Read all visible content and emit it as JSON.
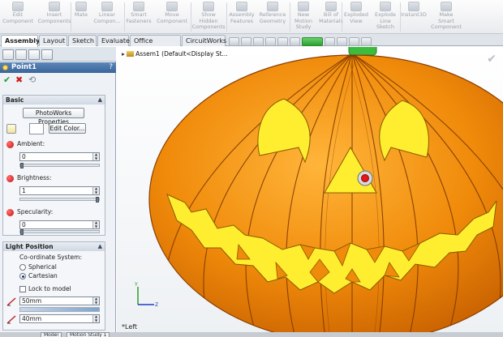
{
  "ribbon": {
    "items": [
      {
        "label": "Edit\nComponent",
        "icon": "edit-component-icon"
      },
      {
        "label": "Insert\nComponents",
        "icon": "insert-components-icon"
      },
      {
        "label": "Mate",
        "icon": "mate-icon"
      },
      {
        "label": "Linear\nCompon...",
        "icon": "linear-pattern-icon"
      },
      {
        "label": "Smart\nFasteners",
        "icon": "smart-fasteners-icon"
      },
      {
        "label": "Move\nComponent",
        "icon": "move-component-icon"
      },
      {
        "label": "Show\nHidden\nComponents",
        "icon": "show-hidden-icon"
      },
      {
        "label": "Assembly\nFeatures",
        "icon": "assembly-features-icon"
      },
      {
        "label": "Reference\nGeometry",
        "icon": "reference-geometry-icon"
      },
      {
        "label": "New\nMotion\nStudy",
        "icon": "new-motion-study-icon"
      },
      {
        "label": "Bill of\nMaterials",
        "icon": "bill-of-materials-icon"
      },
      {
        "label": "Exploded\nView",
        "icon": "exploded-view-icon"
      },
      {
        "label": "Explode\nLine\nSketch",
        "icon": "explode-line-sketch-icon"
      },
      {
        "label": "Instant3D",
        "icon": "instant3d-icon"
      },
      {
        "label": "Make\nSmart\nComponent",
        "icon": "make-smart-component-icon"
      }
    ]
  },
  "tabs": [
    "Assembly",
    "Layout",
    "Sketch",
    "Evaluate",
    "Office Products",
    "CircuitWorks"
  ],
  "active_tab": "Assembly",
  "property_manager": {
    "title": "Point1",
    "help": "?",
    "ok_symbol": "✔",
    "cancel_symbol": "✖",
    "pin_symbol": "⟲",
    "basic": {
      "header": "Basic",
      "photoworks_button": "PhotoWorks Properties",
      "edit_color_button": "Edit Color...",
      "ambient_label": "Ambient:",
      "ambient_value": "0",
      "ambient_level": 0.0,
      "brightness_label": "Brightness:",
      "brightness_value": "1",
      "brightness_level": 1.0,
      "specularity_label": "Specularity:",
      "specularity_value": "0",
      "specularity_level": 0.0
    },
    "light_position": {
      "header": "Light Position",
      "coordinate_label": "Co-ordinate System:",
      "options": [
        "Spherical",
        "Cartesian"
      ],
      "selected_option": "Cartesian",
      "lock_label": "Lock to model",
      "lock_checked": false,
      "x_value": "50mm",
      "y_value": "40mm"
    }
  },
  "viewport": {
    "tree_item": "Assem1  (Default<Display St...",
    "view_label": "*Left"
  },
  "bottom_tabs": [
    "Model",
    "Motion Study 1"
  ],
  "colors": {
    "pumpkin": "#f08a0a",
    "pumpkin_dark": "#c75f00",
    "face": "#ffee30",
    "stem": "#3cbc3c",
    "panel_header": "#38659b"
  }
}
